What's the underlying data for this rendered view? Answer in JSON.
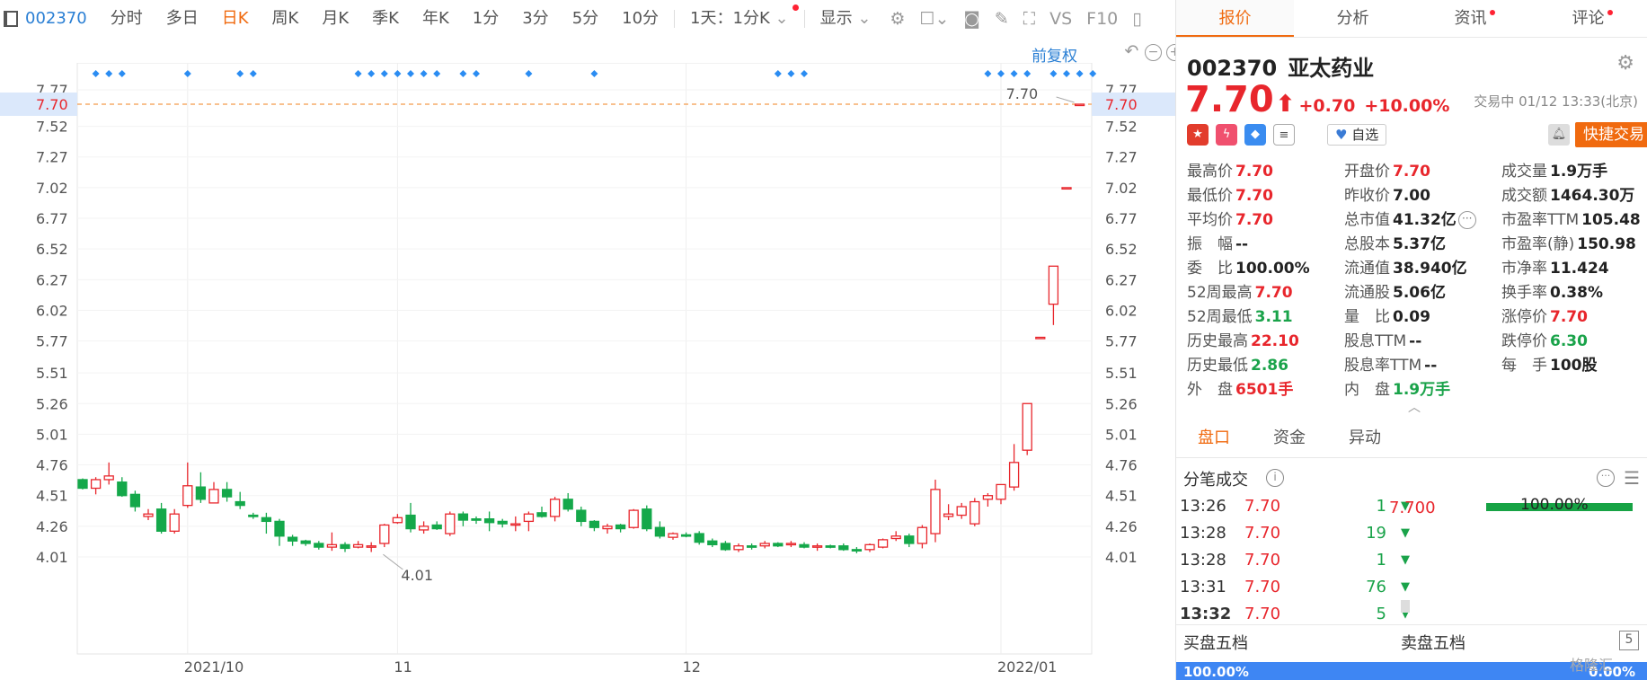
{
  "toolbar": {
    "code": "002370",
    "items": [
      "分时",
      "多日",
      "日K",
      "周K",
      "月K",
      "季K",
      "年K",
      "1分",
      "3分",
      "5分",
      "10分",
      "1天：1分K",
      "显示"
    ],
    "active": "日K",
    "icons": [
      "gear-icon",
      "square-icon",
      "camera-icon",
      "pencil-icon",
      "expand-icon",
      "vs-icon",
      "f10-icon",
      "sidebar-icon"
    ],
    "vs_label": "VS",
    "f10_label": "F10"
  },
  "chart_controls": {
    "fuquan": "前复权"
  },
  "chart_data": {
    "type": "candlestick",
    "y_ticks": [
      "7.77",
      "7.70",
      "7.52",
      "7.27",
      "7.02",
      "6.77",
      "6.52",
      "6.27",
      "6.02",
      "5.77",
      "5.51",
      "5.26",
      "5.01",
      "4.76",
      "4.51",
      "4.26",
      "4.01"
    ],
    "x_ticks": [
      {
        "label": "2021/10",
        "index": 8
      },
      {
        "label": "11",
        "index": 24
      },
      {
        "label": "12",
        "index": 46
      },
      {
        "label": "2022/01",
        "index": 70
      }
    ],
    "last_price": 7.7,
    "last_label": "7.70",
    "high_label": "7.70",
    "low_label": "4.01",
    "low_index": 24,
    "colors": {
      "up": "#e8262c",
      "down": "#14a84a",
      "dashed": "#f39b4a",
      "diamond": "#2a8cf2"
    },
    "diamond_indices": [
      1,
      2,
      3,
      8,
      12,
      13,
      21,
      22,
      23,
      24,
      25,
      26,
      27,
      29,
      30,
      34,
      39,
      53,
      54,
      55,
      69,
      70,
      71,
      72,
      74,
      75,
      76,
      77
    ],
    "ohlc": [
      [
        4.64,
        4.65,
        4.56,
        4.57
      ],
      [
        4.57,
        4.66,
        4.52,
        4.64
      ],
      [
        4.64,
        4.78,
        4.6,
        4.67
      ],
      [
        4.62,
        4.66,
        4.5,
        4.51
      ],
      [
        4.52,
        4.55,
        4.38,
        4.42
      ],
      [
        4.34,
        4.4,
        4.31,
        4.36
      ],
      [
        4.4,
        4.45,
        4.2,
        4.22
      ],
      [
        4.22,
        4.4,
        4.2,
        4.36
      ],
      [
        4.43,
        4.78,
        4.41,
        4.59
      ],
      [
        4.58,
        4.7,
        4.45,
        4.48
      ],
      [
        4.45,
        4.62,
        4.45,
        4.56
      ],
      [
        4.56,
        4.62,
        4.46,
        4.5
      ],
      [
        4.46,
        4.54,
        4.4,
        4.43
      ],
      [
        4.35,
        4.37,
        4.32,
        4.34
      ],
      [
        4.33,
        4.37,
        4.2,
        4.3
      ],
      [
        4.3,
        4.32,
        4.1,
        4.18
      ],
      [
        4.17,
        4.19,
        4.1,
        4.14
      ],
      [
        4.14,
        4.15,
        4.1,
        4.12
      ],
      [
        4.12,
        4.14,
        4.07,
        4.09
      ],
      [
        4.09,
        4.21,
        4.06,
        4.11
      ],
      [
        4.11,
        4.13,
        4.05,
        4.08
      ],
      [
        4.09,
        4.14,
        4.08,
        4.11
      ],
      [
        4.09,
        4.13,
        4.05,
        4.1
      ],
      [
        4.12,
        4.28,
        4.09,
        4.27
      ],
      [
        4.29,
        4.36,
        4.28,
        4.33
      ],
      [
        4.35,
        4.45,
        4.21,
        4.24
      ],
      [
        4.23,
        4.3,
        4.2,
        4.26
      ],
      [
        4.27,
        4.3,
        4.23,
        4.24
      ],
      [
        4.2,
        4.38,
        4.18,
        4.36
      ],
      [
        4.36,
        4.38,
        4.26,
        4.31
      ],
      [
        4.32,
        4.34,
        4.28,
        4.31
      ],
      [
        4.32,
        4.38,
        4.22,
        4.29
      ],
      [
        4.3,
        4.32,
        4.25,
        4.28
      ],
      [
        4.27,
        4.34,
        4.22,
        4.28
      ],
      [
        4.3,
        4.38,
        4.22,
        4.36
      ],
      [
        4.37,
        4.42,
        4.33,
        4.34
      ],
      [
        4.34,
        4.5,
        4.3,
        4.48
      ],
      [
        4.48,
        4.53,
        4.38,
        4.4
      ],
      [
        4.39,
        4.42,
        4.26,
        4.3
      ],
      [
        4.3,
        4.31,
        4.22,
        4.25
      ],
      [
        4.24,
        4.28,
        4.2,
        4.26
      ],
      [
        4.27,
        4.28,
        4.21,
        4.24
      ],
      [
        4.25,
        4.4,
        4.24,
        4.39
      ],
      [
        4.4,
        4.43,
        4.22,
        4.24
      ],
      [
        4.25,
        4.3,
        4.16,
        4.18
      ],
      [
        4.17,
        4.21,
        4.15,
        4.2
      ],
      [
        4.19,
        4.21,
        4.17,
        4.18
      ],
      [
        4.2,
        4.22,
        4.11,
        4.13
      ],
      [
        4.14,
        4.16,
        4.09,
        4.11
      ],
      [
        4.12,
        4.14,
        4.06,
        4.07
      ],
      [
        4.07,
        4.12,
        4.05,
        4.1
      ],
      [
        4.1,
        4.12,
        4.07,
        4.09
      ],
      [
        4.1,
        4.14,
        4.08,
        4.12
      ],
      [
        4.12,
        4.13,
        4.09,
        4.1
      ],
      [
        4.11,
        4.14,
        4.09,
        4.12
      ],
      [
        4.11,
        4.13,
        4.08,
        4.09
      ],
      [
        4.09,
        4.12,
        4.06,
        4.1
      ],
      [
        4.1,
        4.11,
        4.08,
        4.09
      ],
      [
        4.1,
        4.12,
        4.06,
        4.07
      ],
      [
        4.07,
        4.09,
        4.04,
        4.06
      ],
      [
        4.07,
        4.12,
        4.05,
        4.11
      ],
      [
        4.09,
        4.16,
        4.08,
        4.15
      ],
      [
        4.16,
        4.22,
        4.14,
        4.18
      ],
      [
        4.18,
        4.2,
        4.09,
        4.12
      ],
      [
        4.12,
        4.27,
        4.08,
        4.25
      ],
      [
        4.2,
        4.64,
        4.13,
        4.56
      ],
      [
        4.34,
        4.44,
        4.31,
        4.36
      ],
      [
        4.35,
        4.45,
        4.32,
        4.42
      ],
      [
        4.28,
        4.49,
        4.26,
        4.46
      ],
      [
        4.48,
        4.53,
        4.42,
        4.51
      ],
      [
        4.48,
        4.6,
        4.44,
        4.6
      ],
      [
        4.58,
        4.93,
        4.55,
        4.78
      ],
      [
        4.88,
        5.26,
        4.84,
        5.26
      ],
      [
        5.8,
        5.8,
        5.8,
        5.8
      ],
      [
        6.07,
        6.38,
        5.9,
        6.38
      ],
      [
        7.02,
        7.02,
        7.02,
        7.02
      ],
      [
        7.7,
        7.7,
        7.7,
        7.7
      ]
    ]
  },
  "tabs": [
    {
      "label": "报价",
      "active": true,
      "dot": false
    },
    {
      "label": "分析",
      "active": false,
      "dot": false
    },
    {
      "label": "资讯",
      "active": false,
      "dot": true
    },
    {
      "label": "评论",
      "active": false,
      "dot": true
    }
  ],
  "stock": {
    "code": "002370",
    "name": "亚太药业",
    "price": "7.70",
    "arrow": "⬆",
    "change": "+0.70",
    "change_pct": "+10.00%",
    "status_time": "交易中 01/12 13:33(北京)"
  },
  "actions": {
    "zixuan": "自选",
    "quick_trade": "快捷交易",
    "icons": [
      "china-flag-icon",
      "lightning-icon",
      "tag-icon",
      "note-icon",
      "heart-icon",
      "bell-icon"
    ]
  },
  "stats": [
    [
      {
        "label": "最高价",
        "value": "7.70",
        "color": "red"
      },
      {
        "label": "开盘价",
        "value": "7.70",
        "color": "red"
      },
      {
        "label": "成交量",
        "value": "1.9万手",
        "color": ""
      }
    ],
    [
      {
        "label": "最低价",
        "value": "7.70",
        "color": "red"
      },
      {
        "label": "昨收价",
        "value": "7.00",
        "color": ""
      },
      {
        "label": "成交额",
        "value": "1464.30万",
        "color": ""
      }
    ],
    [
      {
        "label": "平均价",
        "value": "7.70",
        "color": "red"
      },
      {
        "label": "总市值",
        "value": "41.32亿",
        "color": "",
        "more": true
      },
      {
        "label": "市盈率TTM",
        "value": "105.48",
        "color": ""
      }
    ],
    [
      {
        "label": "振　幅",
        "value": "--",
        "color": ""
      },
      {
        "label": "总股本",
        "value": "5.37亿",
        "color": ""
      },
      {
        "label": "市盈率(静)",
        "value": "150.98",
        "color": ""
      }
    ],
    [
      {
        "label": "委　比",
        "value": "100.00%",
        "color": ""
      },
      {
        "label": "流通值",
        "value": "38.940亿",
        "color": ""
      },
      {
        "label": "市净率",
        "value": "11.424",
        "color": ""
      }
    ],
    [
      {
        "label": "52周最高",
        "value": "7.70",
        "color": "red"
      },
      {
        "label": "流通股",
        "value": "5.06亿",
        "color": ""
      },
      {
        "label": "换手率",
        "value": "0.38%",
        "color": ""
      }
    ],
    [
      {
        "label": "52周最低",
        "value": "3.11",
        "color": "green"
      },
      {
        "label": "量　比",
        "value": "0.09",
        "color": ""
      },
      {
        "label": "涨停价",
        "value": "7.70",
        "color": "red"
      }
    ],
    [
      {
        "label": "历史最高",
        "value": "22.10",
        "color": "red"
      },
      {
        "label": "股息TTM",
        "value": "--",
        "color": ""
      },
      {
        "label": "跌停价",
        "value": "6.30",
        "color": "green"
      }
    ],
    [
      {
        "label": "历史最低",
        "value": "2.86",
        "color": "green"
      },
      {
        "label": "股息率TTM",
        "value": "--",
        "color": ""
      },
      {
        "label": "每　手",
        "value": "100股",
        "color": ""
      }
    ],
    [
      {
        "label": "外　盘",
        "value": "6501手",
        "color": "red"
      },
      {
        "label": "内　盘",
        "value": "1.9万手",
        "color": "green"
      }
    ]
  ],
  "subtabs": [
    {
      "label": "盘口",
      "active": true
    },
    {
      "label": "资金",
      "active": false
    },
    {
      "label": "异动",
      "active": false
    }
  ],
  "ticks": {
    "title": "分笔成交",
    "rows": [
      {
        "time": "13:26",
        "price": "7.70",
        "vol": "1"
      },
      {
        "time": "13:28",
        "price": "7.70",
        "vol": "19"
      },
      {
        "time": "13:28",
        "price": "7.70",
        "vol": "1"
      },
      {
        "time": "13:31",
        "price": "7.70",
        "vol": "76"
      },
      {
        "time": "13:32",
        "price": "7.70",
        "vol": "5"
      }
    ],
    "arrow": "▼"
  },
  "distribution": {
    "price": "7.700",
    "pct": "100.00%"
  },
  "book": {
    "buy_title": "买盘五档",
    "sell_title": "卖盘五档",
    "five_label": "5",
    "buy_pct": "100.00%",
    "sell_pct": "0.00%"
  },
  "watermark": "格隆汇"
}
